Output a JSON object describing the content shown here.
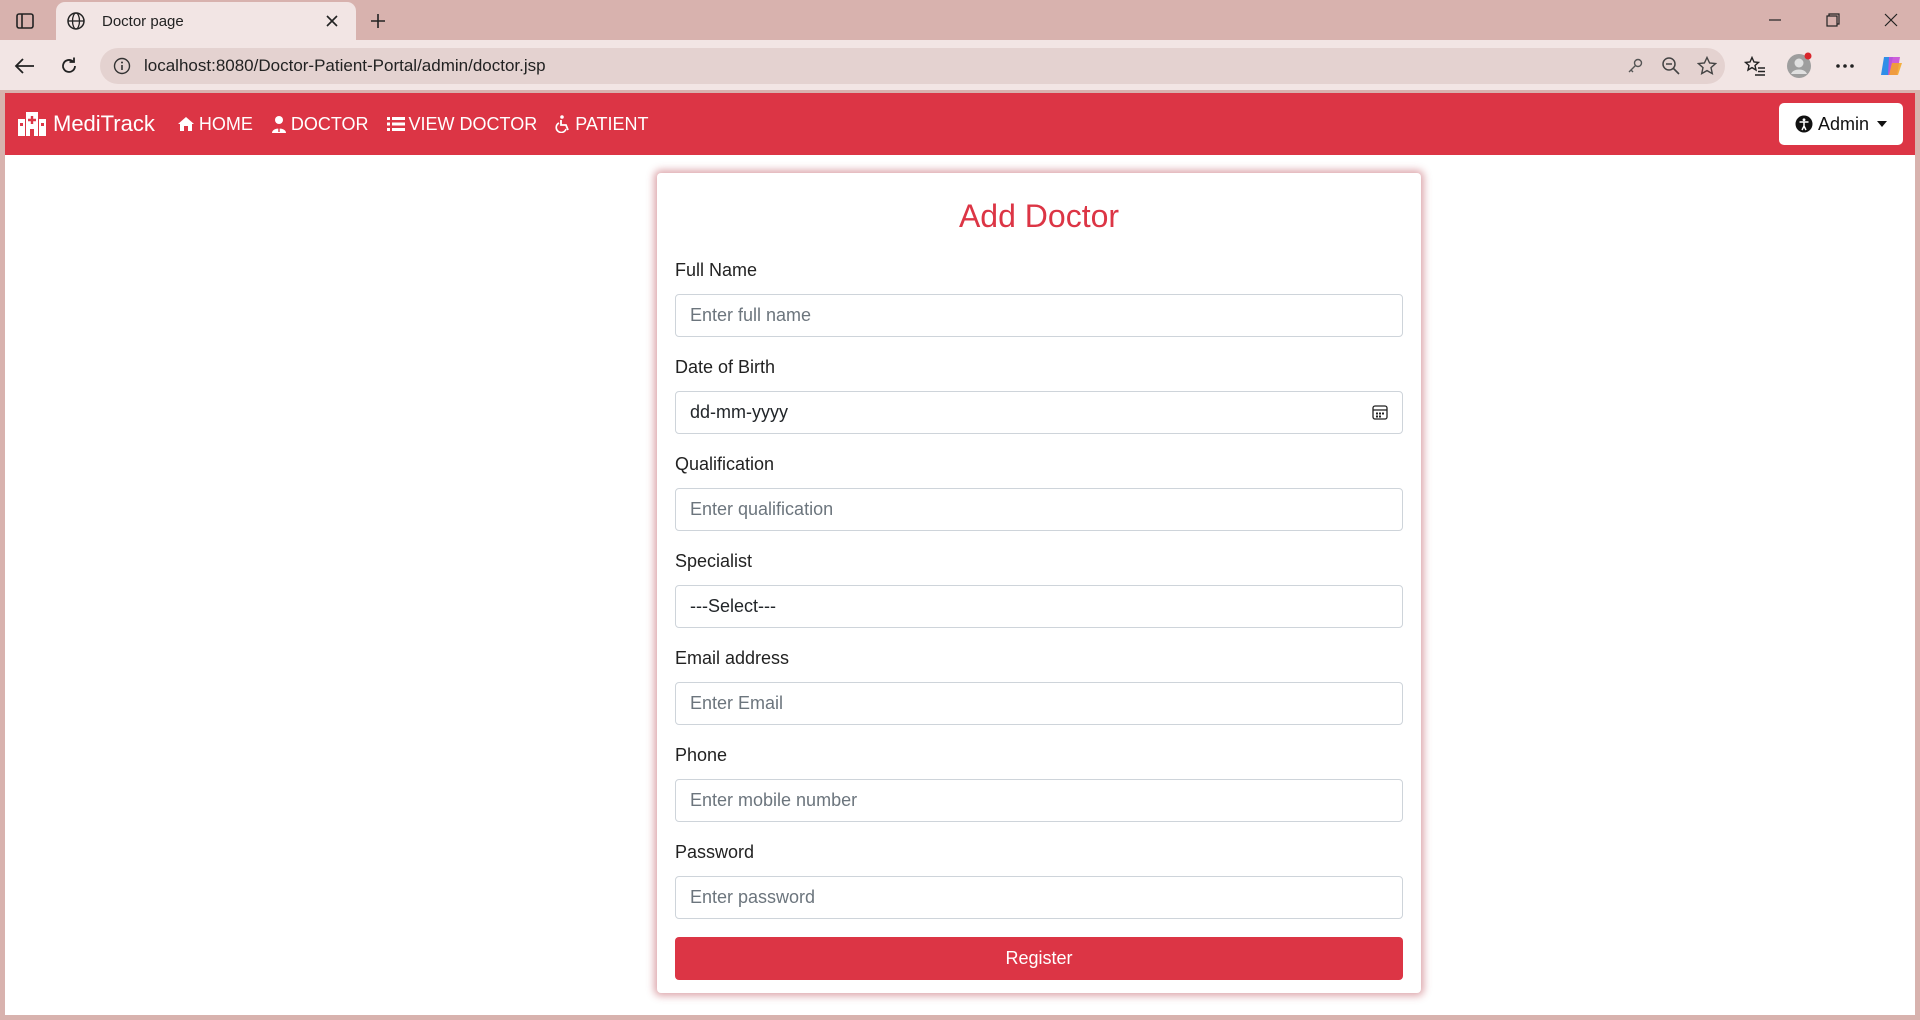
{
  "browser": {
    "tab_title": "Doctor page",
    "url": "localhost:8080/Doctor-Patient-Portal/admin/doctor.jsp"
  },
  "navbar": {
    "brand": "MediTrack",
    "links": [
      {
        "label": "HOME",
        "icon": "home-icon"
      },
      {
        "label": "DOCTOR",
        "icon": "user-doctor-icon"
      },
      {
        "label": "VIEW DOCTOR",
        "icon": "list-icon"
      },
      {
        "label": "PATIENT",
        "icon": "wheelchair-icon"
      }
    ],
    "admin_label": "Admin",
    "color": "#dc3545"
  },
  "form": {
    "title": "Add Doctor",
    "fields": [
      {
        "label": "Full Name",
        "placeholder": "Enter full name"
      },
      {
        "label": "Date of Birth",
        "value": "dd-mm-yyyy"
      },
      {
        "label": "Qualification",
        "placeholder": "Enter qualification"
      },
      {
        "label": "Specialist",
        "value": "---Select---"
      },
      {
        "label": "Email address",
        "placeholder": "Enter Email"
      },
      {
        "label": "Phone",
        "placeholder": "Enter mobile number"
      },
      {
        "label": "Password",
        "placeholder": "Enter password"
      }
    ],
    "submit_label": "Register"
  }
}
